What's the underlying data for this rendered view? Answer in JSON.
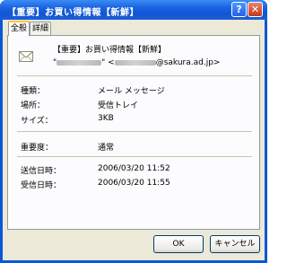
{
  "window": {
    "title": "【重要】お買い得情報【新鮮】"
  },
  "title_buttons": {
    "help": "?",
    "close": "✕"
  },
  "tabs": [
    {
      "label": "全般",
      "active": true
    },
    {
      "label": "詳細",
      "active": false
    }
  ],
  "message": {
    "icon": "envelope-icon",
    "subject": "【重要】お買い得情報【新鮮】",
    "from_prefix": "\"",
    "from_suffix": "\" <",
    "from_domain": "@sakura.ad.jp>"
  },
  "properties": [
    {
      "label": "種類：",
      "value": "メール メッセージ"
    },
    {
      "label": "場所：",
      "value": "受信トレイ"
    },
    {
      "label": "サイズ：",
      "value": "3KB"
    }
  ],
  "importance": {
    "label": "重要度：",
    "value": "通常"
  },
  "dates": [
    {
      "label": "送信日時：",
      "value": "2006/03/20 11:52"
    },
    {
      "label": "受信日時：",
      "value": "2006/03/20 11:55"
    }
  ],
  "buttons": {
    "ok": "OK",
    "cancel": "キャンセル"
  },
  "colors": {
    "titlebar": "#0f55d6",
    "tab_highlight": "#ffc73c",
    "dialog_bg": "#ece9d8"
  }
}
